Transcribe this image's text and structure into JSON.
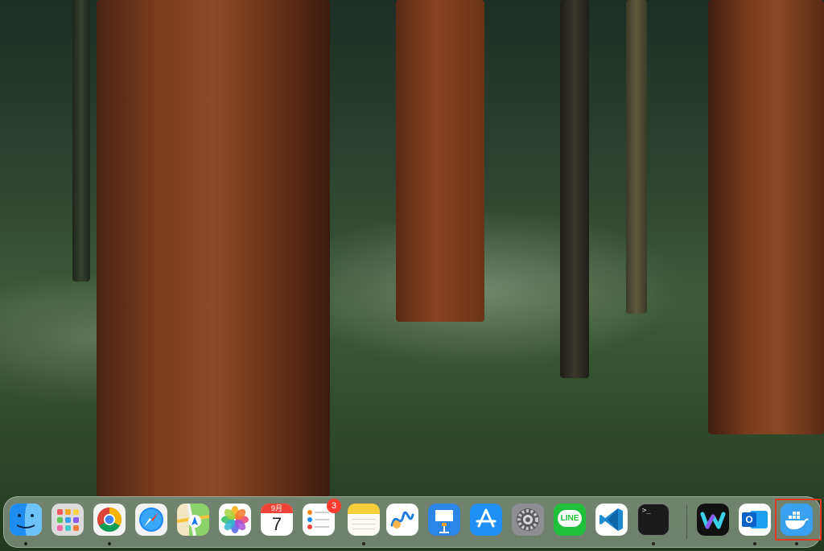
{
  "dock": {
    "items": [
      {
        "name": "Finder",
        "icon": "finder-icon",
        "running": true
      },
      {
        "name": "Launchpad",
        "icon": "launchpad-icon",
        "running": false
      },
      {
        "name": "Google Chrome",
        "icon": "chrome-icon",
        "running": true
      },
      {
        "name": "Safari",
        "icon": "safari-icon",
        "running": false
      },
      {
        "name": "Maps",
        "icon": "maps-icon",
        "running": false
      },
      {
        "name": "Photos",
        "icon": "photos-icon",
        "running": false
      },
      {
        "name": "Calendar",
        "icon": "calendar-icon",
        "running": false
      },
      {
        "name": "Reminders",
        "icon": "reminders-icon",
        "running": false
      },
      {
        "name": "Notes",
        "icon": "notes-icon",
        "running": true
      },
      {
        "name": "Freeform",
        "icon": "freeform-icon",
        "running": false
      },
      {
        "name": "Keynote",
        "icon": "keynote-icon",
        "running": false
      },
      {
        "name": "App Store",
        "icon": "app-store-icon",
        "running": false
      },
      {
        "name": "System Settings",
        "icon": "settings-gear-icon",
        "running": false
      },
      {
        "name": "LINE",
        "icon": "line-icon",
        "running": false
      },
      {
        "name": "Visual Studio Code",
        "icon": "vscode-icon",
        "running": false
      },
      {
        "name": "Terminal",
        "icon": "terminal-icon",
        "running": true
      },
      {
        "name": "Webex",
        "icon": "webex-icon",
        "running": false
      },
      {
        "name": "Microsoft Outlook",
        "icon": "outlook-icon",
        "running": true
      },
      {
        "name": "Docker",
        "icon": "docker-whale-icon",
        "running": true,
        "selected": true
      }
    ],
    "calendar": {
      "month": "9月",
      "day": "7"
    },
    "reminders_badge": "3",
    "line_label": "LINE",
    "terminal_prompt": ">_",
    "outlook_letter": "O"
  },
  "colors": {
    "highlight": "#e5361f",
    "badge": "#ff3b30"
  }
}
